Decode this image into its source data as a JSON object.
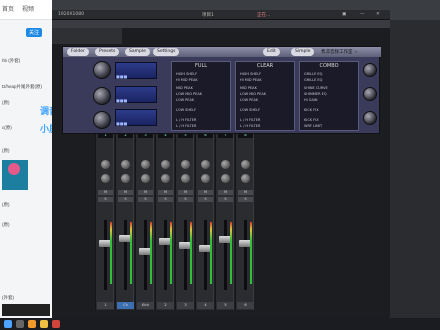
{
  "browser": {
    "nav": [
      "首页",
      "视频"
    ],
    "lines": [
      "hb (外套)",
      "D/heap片尾外套(原)",
      "(原)",
      "c(原)",
      "(原)",
      "(原)",
      "(原)"
    ],
    "button": "关注",
    "promo_text": [
      "调音",
      "小屏幕"
    ],
    "bottom_text": "(外套)"
  },
  "toolbar": {
    "size_label": "1920X1080",
    "status_label": "正在..."
  },
  "window_title": "项目1",
  "plugin": {
    "tabs": [
      "Folder",
      "Presets",
      "Sample",
      "Settings"
    ],
    "right_buttons": [
      "Edit",
      "Simple"
    ],
    "brand": "隽凉音频工作室 ☆",
    "columns": [
      {
        "title": "FULL",
        "rows": [
          "HIGH SHELF",
          "HI MID PEAK",
          "MID PEAK",
          "LOW MID PEAK",
          "LOW PEAK",
          "LOW SHELF",
          "L / H FILTER",
          "L / H FILTER"
        ]
      },
      {
        "title": "CLEAR",
        "rows": [
          "HIGH SHELF",
          "HI MID PEAK",
          "MID PEAK",
          "LOW MID PEAK",
          "LOW PEAK",
          "LOW SHELF",
          "L / H FILTER",
          "L / H FILTER"
        ]
      },
      {
        "title": "COMBO",
        "rows": [
          "GRILLE EQ",
          "GRILLE EQ",
          "SHINE CURVE",
          "SHIMMER EQ",
          "HI GAIN",
          "KICK FIX",
          "KICK FIX",
          "WRF LIMIT"
        ]
      }
    ]
  },
  "mixer": {
    "strip_labels": [
      "1",
      "2",
      "3",
      "4",
      "5",
      "6",
      "7",
      "8"
    ],
    "strip_names": [
      "1",
      "Ch",
      "Kick",
      "2",
      "3",
      "4",
      "5",
      "6"
    ]
  },
  "taskbar": {
    "icons": [
      "start",
      "search",
      "browser",
      "files",
      "app"
    ]
  }
}
